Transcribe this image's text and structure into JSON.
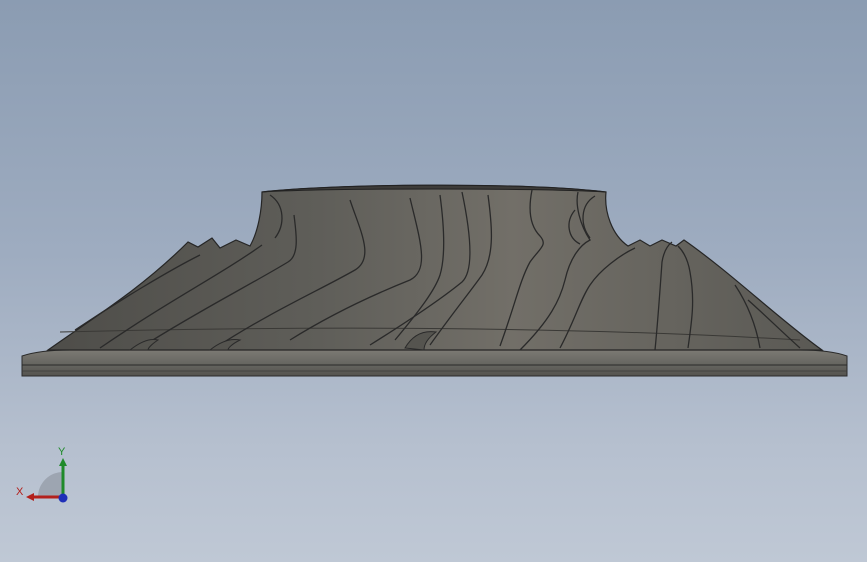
{
  "viewport": {
    "background_top": "#8b9cb2",
    "background_bottom": "#bfc8d5"
  },
  "model": {
    "part_color": "#6b6a65",
    "edge_color": "#2a2a2a"
  },
  "triad": {
    "x_label": "X",
    "y_label": "Y",
    "x_color": "#b3201c",
    "y_color": "#1f8a2a",
    "z_color": "#1f2fb8"
  }
}
